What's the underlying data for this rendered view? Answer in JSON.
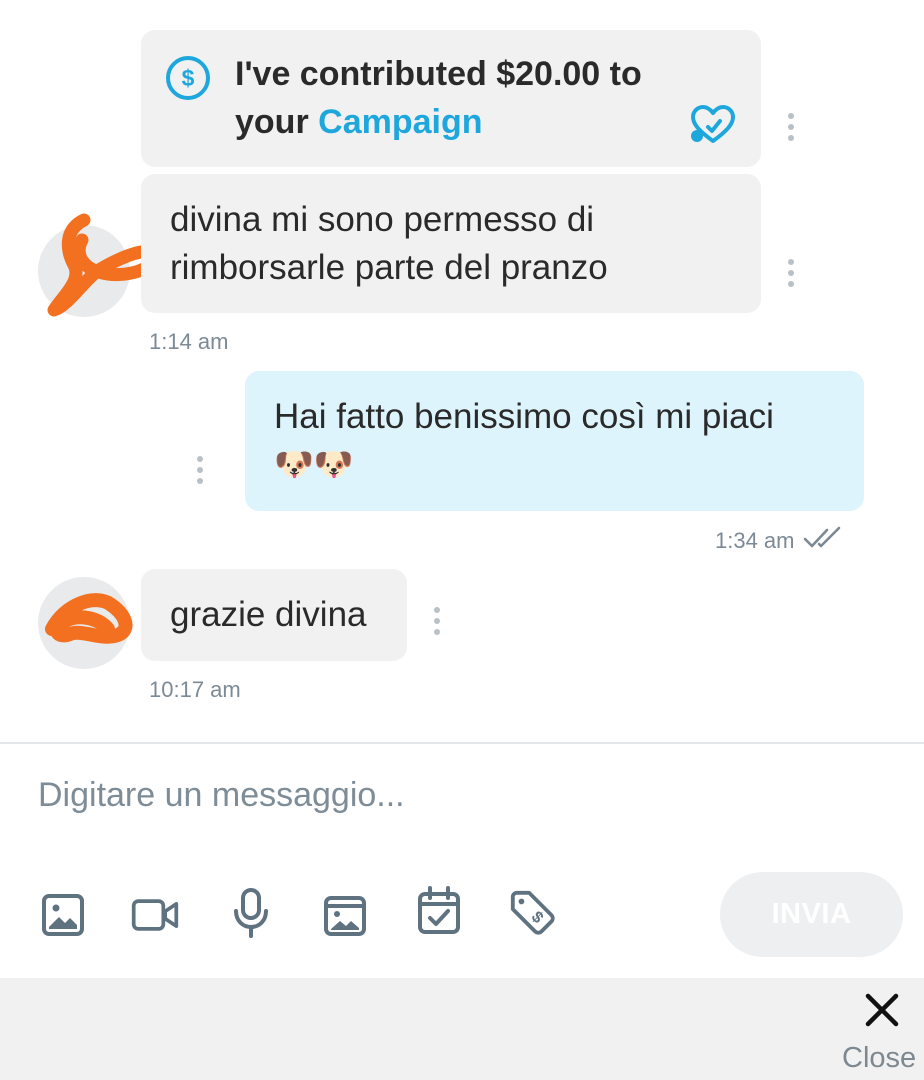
{
  "messages": [
    {
      "type": "contribution",
      "text_prefix": "I've contributed $20.00 to your",
      "link": "Campaign"
    },
    {
      "type": "incoming",
      "text": "divina mi sono permesso di rimborsarle parte del pranzo",
      "time": "1:14 am"
    },
    {
      "type": "outgoing",
      "text": "Hai fatto benissimo così mi piaci",
      "emoji": "🐶🐶",
      "time": "1:34 am"
    },
    {
      "type": "incoming",
      "text": "grazie divina",
      "time": "10:17 am"
    }
  ],
  "composer": {
    "placeholder": "Digitare un messaggio...",
    "send_label": "INVIA",
    "tools": [
      "image-icon",
      "video-camera-icon",
      "microphone-icon",
      "gallery-icon",
      "calendar-check-icon",
      "price-tag-icon"
    ]
  },
  "footer": {
    "close_label": "Close"
  },
  "colors": {
    "accent": "#1ea7dd",
    "outgoing_bubble": "#def4fd",
    "incoming_bubble": "#f1f1f1",
    "icon_gray": "#5f7280",
    "scribble": "#f2701f"
  }
}
